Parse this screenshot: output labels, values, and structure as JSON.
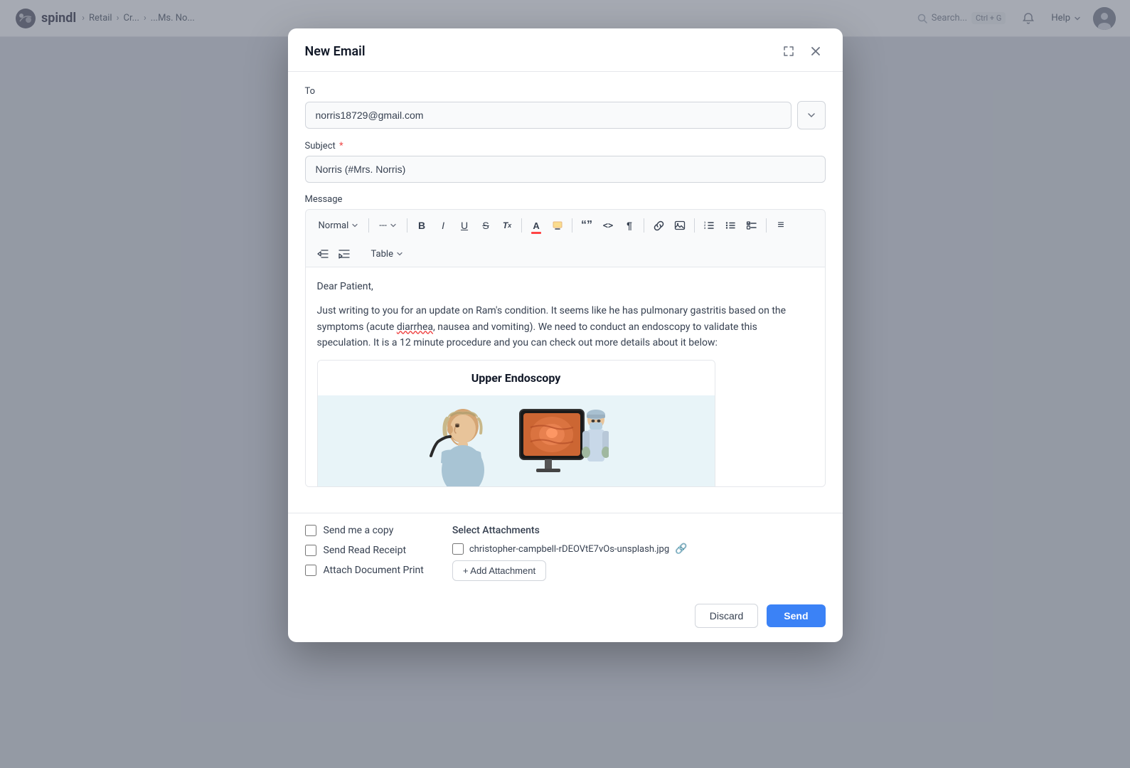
{
  "app": {
    "logo_text": "spindl",
    "breadcrumbs": [
      "Retail",
      "Cr...",
      "...Ms. No..."
    ]
  },
  "header": {
    "search_placeholder": "Search...",
    "search_shortcut": "Ctrl + G",
    "help_label": "Help",
    "notification_icon": "bell-icon",
    "avatar_icon": "avatar-icon"
  },
  "modal": {
    "title": "New Email",
    "expand_icon": "expand-icon",
    "close_icon": "close-icon"
  },
  "to_field": {
    "label": "To",
    "value": "norris18729@gmail.com",
    "dropdown_icon": "chevron-down-icon"
  },
  "subject_field": {
    "label": "Subject",
    "required": true,
    "value": "Norris (#Mrs. Norris)"
  },
  "message_field": {
    "label": "Message",
    "paragraph1": "Dear Patient,",
    "paragraph2": "Just writing to you for an update on Ram's condition. It seems like he has pulmonary gastritis based on the symptoms (acute diarrhea, nausea and vomiting). We need to conduct an endoscopy to validate this speculation. It is a 12 minute procedure and you can check out more details about it below:",
    "underlined_word": "diarrhea"
  },
  "toolbar": {
    "style_select": "Normal",
    "style_select_icon": "chevron-down-icon",
    "separator1": "---",
    "separator1_icon": "chevron-down-icon",
    "buttons": [
      {
        "name": "bold-btn",
        "label": "B",
        "style": "bold"
      },
      {
        "name": "italic-btn",
        "label": "I",
        "style": "italic"
      },
      {
        "name": "underline-btn",
        "label": "U",
        "style": "underline"
      },
      {
        "name": "strikethrough-btn",
        "label": "S",
        "style": "strikethrough"
      },
      {
        "name": "clear-format-btn",
        "label": "Tx"
      },
      {
        "name": "font-color-btn",
        "label": "A"
      },
      {
        "name": "highlight-btn",
        "label": "H"
      },
      {
        "name": "blockquote-btn",
        "label": "“”"
      },
      {
        "name": "code-btn",
        "label": "<>"
      },
      {
        "name": "paragraph-btn",
        "label": "¶"
      },
      {
        "name": "link-btn",
        "label": "🔗"
      },
      {
        "name": "image-btn",
        "label": "🖼"
      },
      {
        "name": "ordered-list-btn",
        "label": "OL"
      },
      {
        "name": "unordered-list-btn",
        "label": "UL"
      },
      {
        "name": "task-list-btn",
        "label": "TL"
      },
      {
        "name": "align-btn",
        "label": "≡"
      }
    ],
    "row2_buttons": [
      {
        "name": "outdent-btn",
        "label": "⇤"
      },
      {
        "name": "indent-btn",
        "label": "⇥"
      },
      {
        "name": "table-btn",
        "label": "Table"
      },
      {
        "name": "table-dropdown-icon",
        "label": "▾"
      }
    ]
  },
  "embedded_image": {
    "title": "Upper Endoscopy",
    "alt": "Upper Endoscopy procedure illustration"
  },
  "checkboxes": [
    {
      "name": "send-copy-checkbox",
      "label": "Send me a copy",
      "checked": false
    },
    {
      "name": "read-receipt-checkbox",
      "label": "Send Read Receipt",
      "checked": false
    },
    {
      "name": "attach-print-checkbox",
      "label": "Attach Document Print",
      "checked": false
    }
  ],
  "attachments": {
    "label": "Select Attachments",
    "items": [
      {
        "name": "attachment-1",
        "filename": "christopher-campbell-rDEOVtE7vOs-unsplash.jpg",
        "checked": false
      }
    ],
    "add_button_label": "+ Add Attachment"
  },
  "actions": {
    "discard_label": "Discard",
    "send_label": "Send"
  }
}
